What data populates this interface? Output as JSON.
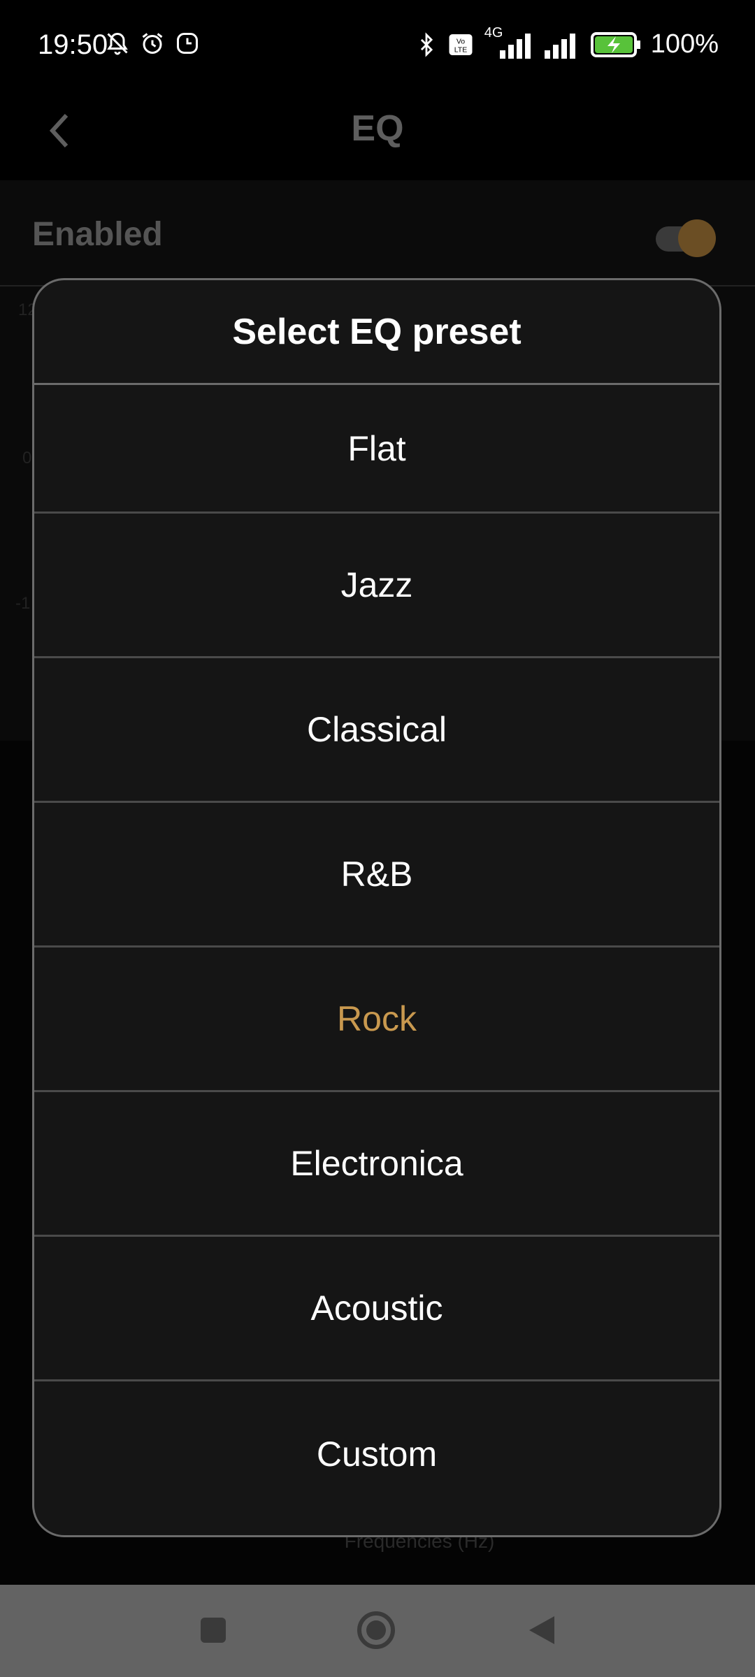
{
  "status_bar": {
    "time": "19:50",
    "battery_text": "100%",
    "network_label": "4G",
    "icons": [
      "bell-off-icon",
      "alarm-icon",
      "timer-icon",
      "bluetooth-icon",
      "volte-icon",
      "signal-icon",
      "signal-icon-2",
      "battery-charging-icon"
    ]
  },
  "header": {
    "title": "EQ",
    "back_icon": "chevron-left-icon"
  },
  "background": {
    "enabled_label": "Enabled",
    "enabled_on": true,
    "ghost_labels": [
      "12",
      "0",
      "-1"
    ],
    "frequency_label": "Frequencies (Hz)"
  },
  "dialog": {
    "title": "Select EQ preset",
    "options": [
      {
        "label": "Flat"
      },
      {
        "label": "Jazz"
      },
      {
        "label": "Classical"
      },
      {
        "label": "R&B"
      },
      {
        "label": "Rock",
        "selected": true
      },
      {
        "label": "Electronica"
      },
      {
        "label": "Acoustic"
      },
      {
        "label": "Custom"
      }
    ]
  },
  "colors": {
    "accent": "#c9994f",
    "modal_bg": "#151515",
    "modal_border": "#6b6b6b",
    "navbar": "#636363"
  },
  "navbar": {
    "buttons": [
      "recent-apps-icon",
      "home-icon",
      "back-icon"
    ]
  }
}
